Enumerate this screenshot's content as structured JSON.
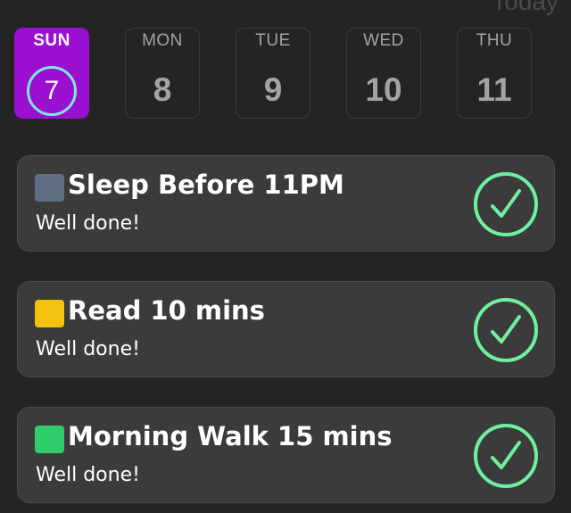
{
  "header": {
    "today_label": "Today"
  },
  "days": [
    {
      "dow": "SUN",
      "num": "7",
      "selected": true
    },
    {
      "dow": "MON",
      "num": "8",
      "selected": false
    },
    {
      "dow": "TUE",
      "num": "9",
      "selected": false
    },
    {
      "dow": "WED",
      "num": "10",
      "selected": false
    },
    {
      "dow": "THU",
      "num": "11",
      "selected": false
    }
  ],
  "habits": [
    {
      "title": "Sleep Before 11PM",
      "status": "Well done!",
      "color": "#5f6e82",
      "completed": true
    },
    {
      "title": "Read 10 mins",
      "status": "Well done!",
      "color": "#f2c20f",
      "completed": true
    },
    {
      "title": "Morning Walk 15 mins",
      "status": "Well done!",
      "color": "#2fcd6c",
      "completed": true
    }
  ],
  "colors": {
    "background": "#242424",
    "card": "#3b3b3b",
    "selected_day": "#9a0fd0",
    "today_ring": "#7de8e4",
    "check": "#6ef0a0"
  },
  "icons": {
    "check": "check-circle-icon"
  }
}
